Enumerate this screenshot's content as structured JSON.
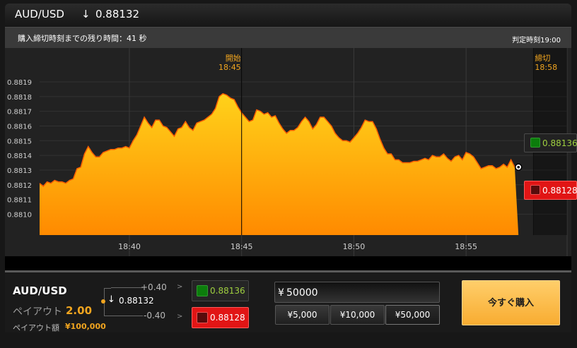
{
  "header": {
    "pair": "AUD/USD",
    "arrow": "↓",
    "price": "0.88132"
  },
  "info": {
    "remaining": "購入締切時刻までの残り時間：41 秒",
    "judge_time": "判定時刻19:00"
  },
  "chart_data": {
    "type": "area",
    "x": [
      "18:36:00",
      "18:36:10",
      "18:36:20",
      "18:36:30",
      "18:36:40",
      "18:36:50",
      "18:37:00",
      "18:37:10",
      "18:37:20",
      "18:37:30",
      "18:37:40",
      "18:37:50",
      "18:38:00",
      "18:38:10",
      "18:38:20",
      "18:38:30",
      "18:38:40",
      "18:38:50",
      "18:39:00",
      "18:39:10",
      "18:39:20",
      "18:39:30",
      "18:39:40",
      "18:39:50",
      "18:40:00",
      "18:40:10",
      "18:40:20",
      "18:40:30",
      "18:40:40",
      "18:40:50",
      "18:41:00",
      "18:41:10",
      "18:41:20",
      "18:41:30",
      "18:41:40",
      "18:41:50",
      "18:42:00",
      "18:42:10",
      "18:42:20",
      "18:42:30",
      "18:42:40",
      "18:42:50",
      "18:43:00",
      "18:43:10",
      "18:43:20",
      "18:43:30",
      "18:43:40",
      "18:43:50",
      "18:44:00",
      "18:44:10",
      "18:44:20",
      "18:44:30",
      "18:44:40",
      "18:44:50",
      "18:45:00",
      "18:45:10",
      "18:45:20",
      "18:45:30",
      "18:45:40",
      "18:45:50",
      "18:46:00",
      "18:46:10",
      "18:46:20",
      "18:46:30",
      "18:46:40",
      "18:46:50",
      "18:47:00",
      "18:47:10",
      "18:47:20",
      "18:47:30",
      "18:47:40",
      "18:47:50",
      "18:48:00",
      "18:48:10",
      "18:48:20",
      "18:48:30",
      "18:48:40",
      "18:48:50",
      "18:49:00",
      "18:49:10",
      "18:49:20",
      "18:49:30",
      "18:49:40",
      "18:49:50",
      "18:50:00",
      "18:50:10",
      "18:50:20",
      "18:50:30",
      "18:50:40",
      "18:50:50",
      "18:51:00",
      "18:51:10",
      "18:51:20",
      "18:51:30",
      "18:51:40",
      "18:51:50",
      "18:52:00",
      "18:52:10",
      "18:52:20",
      "18:52:30",
      "18:52:40",
      "18:52:50",
      "18:53:00",
      "18:53:10",
      "18:53:20",
      "18:53:30",
      "18:53:40",
      "18:53:50",
      "18:54:00",
      "18:54:10",
      "18:54:20",
      "18:54:30",
      "18:54:40",
      "18:54:50",
      "18:55:00",
      "18:55:10",
      "18:55:20",
      "18:55:30",
      "18:55:40",
      "18:55:50",
      "18:56:00",
      "18:56:10",
      "18:56:20",
      "18:56:30",
      "18:56:40",
      "18:56:50",
      "18:57:00",
      "18:57:10",
      "18:57:20"
    ],
    "values": [
      0.88121,
      0.88119,
      0.88122,
      0.88121,
      0.88123,
      0.88122,
      0.88122,
      0.88121,
      0.88123,
      0.88124,
      0.88131,
      0.88132,
      0.88141,
      0.88146,
      0.88142,
      0.88139,
      0.88139,
      0.88142,
      0.88143,
      0.88144,
      0.88144,
      0.88145,
      0.88145,
      0.88146,
      0.88145,
      0.8815,
      0.88154,
      0.8816,
      0.88166,
      0.88162,
      0.88159,
      0.88164,
      0.88164,
      0.8816,
      0.88159,
      0.88156,
      0.88153,
      0.88158,
      0.88159,
      0.88163,
      0.88159,
      0.88157,
      0.88162,
      0.88163,
      0.88164,
      0.88166,
      0.88168,
      0.88172,
      0.8818,
      0.88182,
      0.88181,
      0.88179,
      0.88178,
      0.88173,
      0.88169,
      0.88166,
      0.88163,
      0.88164,
      0.88171,
      0.8817,
      0.88168,
      0.88169,
      0.88166,
      0.88167,
      0.88162,
      0.88158,
      0.88155,
      0.88157,
      0.88157,
      0.88159,
      0.88163,
      0.88166,
      0.88163,
      0.88158,
      0.88161,
      0.88166,
      0.88166,
      0.88163,
      0.8816,
      0.88155,
      0.88152,
      0.8815,
      0.8815,
      0.88149,
      0.88152,
      0.88155,
      0.88159,
      0.88164,
      0.88163,
      0.88163,
      0.88158,
      0.88151,
      0.88145,
      0.88141,
      0.88141,
      0.88137,
      0.88137,
      0.88135,
      0.88135,
      0.88135,
      0.88136,
      0.88136,
      0.88137,
      0.88138,
      0.88137,
      0.8814,
      0.88139,
      0.88139,
      0.88141,
      0.88138,
      0.88136,
      0.88139,
      0.8814,
      0.88137,
      0.88142,
      0.88141,
      0.88139,
      0.88135,
      0.88131,
      0.88132,
      0.88133,
      0.88133,
      0.88131,
      0.88132,
      0.88134,
      0.88132,
      0.88137,
      0.88132
    ],
    "current_price": 0.88132,
    "current_time": "18:57:20",
    "y_ticks": [
      "0.8819",
      "0.8818",
      "0.8817",
      "0.8816",
      "0.8815",
      "0.8814",
      "0.8813",
      "0.8812",
      "0.8811",
      "0.8810"
    ],
    "x_ticks": [
      "18:40",
      "18:45",
      "18:50",
      "18:55"
    ],
    "y_range": [
      0.88093,
      0.8819
    ],
    "time_range": [
      "18:36:00",
      "18:59:30"
    ],
    "markers": [
      {
        "label": "開始",
        "time_label": "18:45",
        "time": "18:45:00"
      },
      {
        "label": "締切",
        "time_label": "18:58",
        "time": "18:58:00"
      }
    ],
    "quote_up": "0.88136",
    "quote_down": "0.88128"
  },
  "bottom": {
    "pair": "AUD/USD",
    "payout_label": "ペイアウト",
    "payout_value": "2.00",
    "amount_label": "ペイアウト額",
    "amount_value": "¥100,000",
    "plus": "+0.40",
    "minus": "-0.40",
    "mid_arrow": "↓",
    "mid_price": "0.88132",
    "gt_top": ">",
    "gt_bottom": ">",
    "quote_up": "0.88136",
    "quote_down": "0.88128"
  },
  "order": {
    "yen": "¥",
    "amount": "50000",
    "presets": [
      "¥5,000",
      "¥10,000",
      "¥50,000"
    ],
    "buy_label": "今すぐ購入"
  },
  "colors": {
    "accent": "#f1a51f",
    "up": "#9fd03f",
    "down": "#e11515"
  }
}
